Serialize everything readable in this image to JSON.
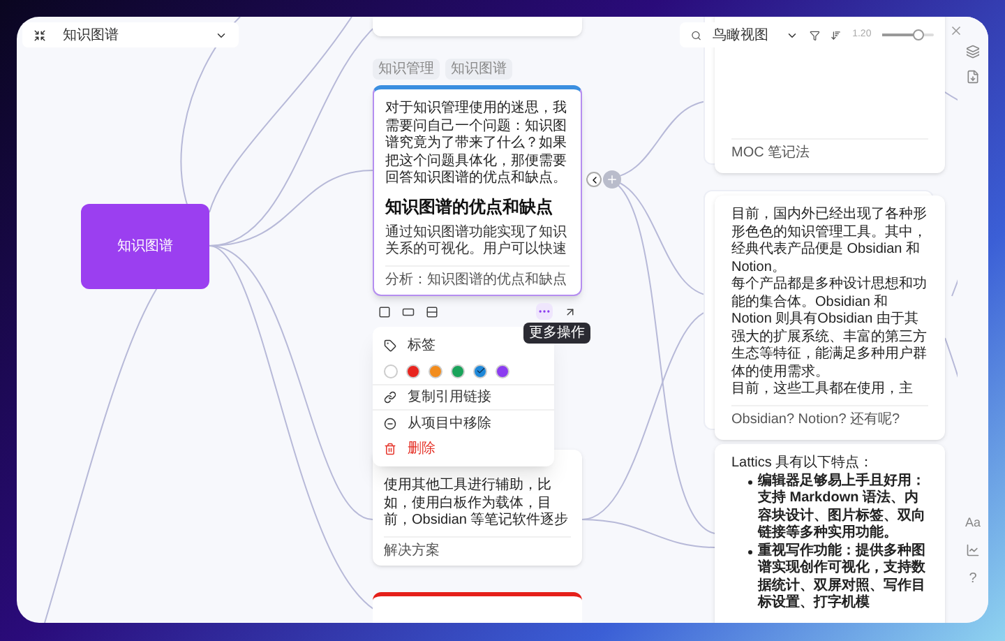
{
  "map_selector": {
    "label": "知识图谱"
  },
  "toolbar": {
    "view": "鸟瞰视图",
    "zoom_reading": "1.20",
    "zoom": {
      "level": 0.7
    }
  },
  "root_node": {
    "label": "知识图谱"
  },
  "main_card": {
    "tags": [
      "知识管理",
      "知识图谱"
    ],
    "selected": true,
    "intro": "对于知识管理使用的迷思，我需要问自己一个问题：知识图谱究竟为了带来了什么？如果把这个问题具体化，那便需要回答知识图谱的优点和缺点。",
    "heading": "知识图谱的优点和缺点",
    "body": "通过知识图谱功能实现了知识关系的可视化。用户可以快速",
    "footer": "分析：知识图谱的优点和缺点"
  },
  "card_toolbar": {
    "more_tooltip": "更多操作"
  },
  "context_menu": {
    "tag_item": "标签",
    "colors": [
      {
        "color": "#ffffff",
        "selected": false
      },
      {
        "color": "#e8251f",
        "selected": false
      },
      {
        "color": "#f28c1c",
        "selected": false
      },
      {
        "color": "#1aa35a",
        "selected": false
      },
      {
        "color": "#1e88d9",
        "selected": true
      },
      {
        "color": "#8b3cf0",
        "selected": false
      }
    ],
    "items": [
      {
        "kind": "link",
        "label": "复制引用链接"
      },
      {
        "kind": "remove",
        "label": "从项目中移除"
      },
      {
        "kind": "delete",
        "label": "删除"
      }
    ]
  },
  "solution_card": {
    "body": "使用其他工具进行辅助，比如，使用白板作为载体，目前，Obsidian 等笔记软件逐步",
    "footer": "解决方案"
  },
  "moc_card": {
    "footer": "MOC 笔记法"
  },
  "tools_card": {
    "lines": [
      "目前，国内外已经出现了各种形形色色的知识管理工具。其中，经典代表产品便是 Obsidian 和 Notion。",
      "每个产品都是多种设计思想和功能的集合体。Obsidian 和 Notion 则具有Obsidian 由于其强大的扩展系统、丰富的第三方生态等特征，能满足多种用户群体的使用需求。",
      "目前，这些工具都在使用，主"
    ],
    "footer": "Obsidian? Notion? 还有呢?"
  },
  "lattics_card": {
    "intro": "Lattics 具有以下特点：",
    "items": [
      "编辑器足够易上手且好用：支持 Markdown 语法、内容块设计、图片标签、双向链接等多种实用功能。",
      "重视写作功能：提供多种图谱实现创作可视化，支持数据统计、双屏对照、写作目标设置、打字机模"
    ]
  },
  "rail": {
    "font_label": "Aa",
    "help_label": "?"
  }
}
